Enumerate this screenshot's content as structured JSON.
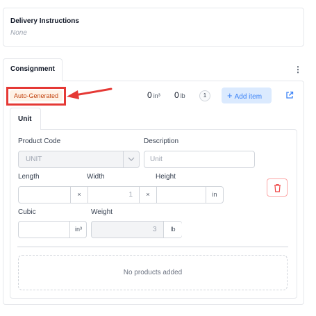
{
  "delivery": {
    "title": "Delivery Instructions",
    "value": "None"
  },
  "consignment": {
    "tab_label": "Consignment",
    "menu_icon": "kebab-menu-icon",
    "badge": "Auto-Generated",
    "annotation_color": "#e53935",
    "totals": {
      "volume_value": "0",
      "volume_unit": "in³",
      "weight_value": "0",
      "weight_unit": "lb",
      "item_count": "1"
    },
    "add_item_label": "Add item",
    "external_link_icon": "external-link-icon"
  },
  "unit": {
    "tab_label": "Unit",
    "product_code": {
      "label": "Product Code",
      "value": "UNIT"
    },
    "description": {
      "label": "Description",
      "placeholder": "Unit"
    },
    "length": {
      "label": "Length",
      "value": ""
    },
    "width": {
      "label": "Width",
      "value": "1"
    },
    "height": {
      "label": "Height",
      "value": "",
      "unit": "in"
    },
    "dim_separator": "×",
    "cubic": {
      "label": "Cubic",
      "value": "",
      "unit": "in³"
    },
    "weight": {
      "label": "Weight",
      "value": "3",
      "unit": "lb"
    },
    "delete_icon": "trash-icon",
    "empty_message": "No products added"
  },
  "colors": {
    "accent_blue": "#3b82f6",
    "add_button_bg": "#dbeafe",
    "badge_text": "#c2410c",
    "badge_bg": "#fef3e7",
    "delete_red": "#ef4444"
  }
}
